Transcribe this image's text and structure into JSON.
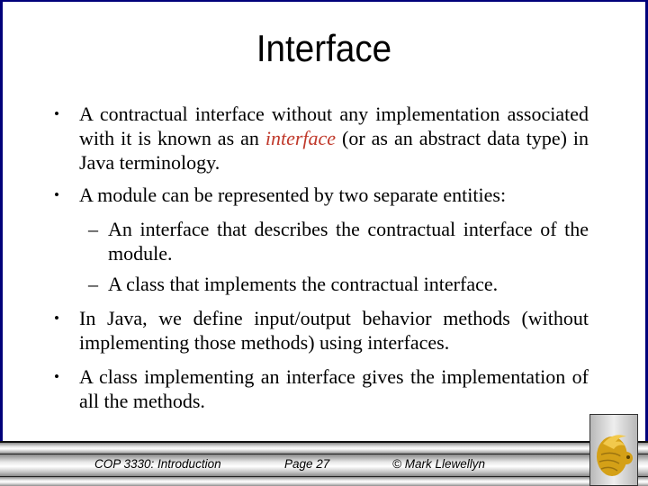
{
  "slide": {
    "title": "Interface",
    "bullets": [
      {
        "pre": "A contractual interface without any implementation associated with it is known as an ",
        "highlight": "interface",
        "post": " (or as an abstract data type) in Java terminology."
      },
      {
        "text": "A module can be represented by two separate entities:"
      },
      {
        "text": "In Java, we define input/output behavior methods (without implementing those methods) using interfaces."
      },
      {
        "text": "A class implementing an interface gives the implementation of all the methods."
      }
    ],
    "sub_bullets": [
      "An interface that describes the contractual interface of the module.",
      "A class that implements the contractual interface."
    ],
    "bullet_glyph": "•",
    "sub_glyph": "–"
  },
  "footer": {
    "course": "COP 3330:  Introduction",
    "page": "Page 27",
    "author": "© Mark Llewellyn",
    "logo_icon": "pegasus-logo-icon"
  },
  "colors": {
    "frame": "#00007a",
    "highlight": "#c0392b",
    "logo_gold": "#d4a017"
  }
}
